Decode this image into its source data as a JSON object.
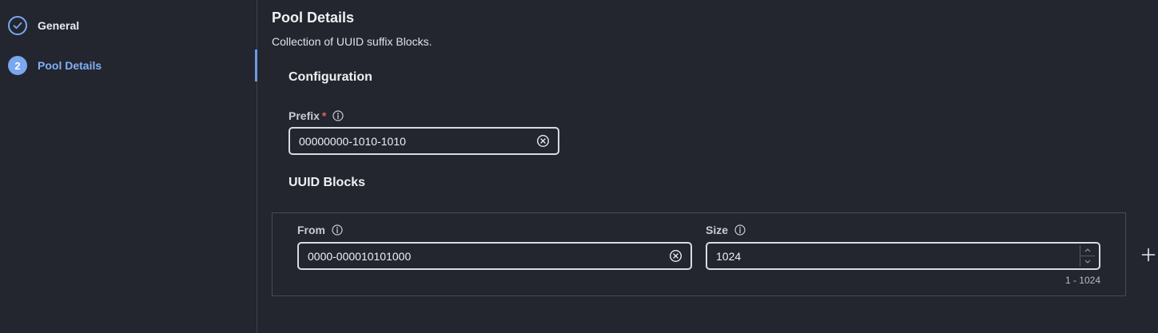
{
  "sidebar": {
    "steps": [
      {
        "label": "General",
        "state": "completed",
        "icon": "check-icon"
      },
      {
        "label": "Pool Details",
        "number": "2",
        "state": "active"
      }
    ]
  },
  "main": {
    "title": "Pool Details",
    "description": "Collection of UUID suffix Blocks.",
    "configuration": {
      "title": "Configuration",
      "prefix": {
        "label": "Prefix",
        "required_mark": "*",
        "value": "00000000-1010-1010"
      }
    },
    "uuid_blocks": {
      "title": "UUID Blocks",
      "from": {
        "label": "From",
        "value": "0000-000010101000"
      },
      "size": {
        "label": "Size",
        "value": "1024",
        "range_hint": "1 - 1024"
      }
    }
  },
  "colors": {
    "background": "#23262f",
    "accent": "#7aa7ef",
    "active_text": "#7fb0f4",
    "required": "#e0605a",
    "border": "#d8dbe0"
  },
  "icons": [
    "check-icon",
    "info-icon",
    "clear-icon",
    "spinner-up-icon",
    "spinner-down-icon",
    "plus-icon"
  ]
}
